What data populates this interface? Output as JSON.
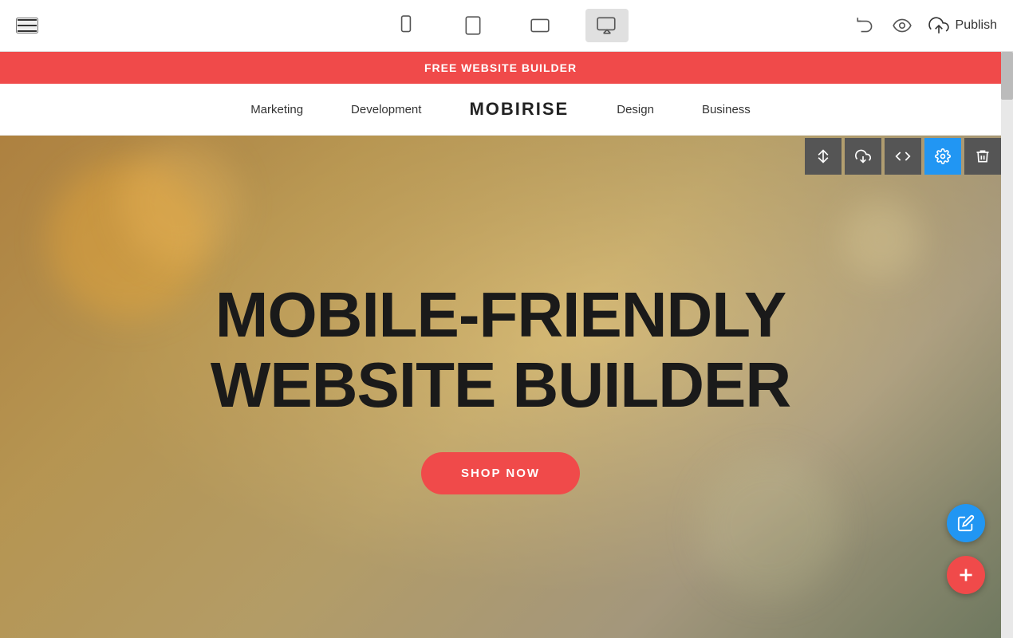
{
  "toolbar": {
    "publish_label": "Publish",
    "devices": [
      {
        "id": "mobile",
        "label": "Mobile",
        "active": false
      },
      {
        "id": "tablet",
        "label": "Tablet",
        "active": false
      },
      {
        "id": "tablet-landscape",
        "label": "Tablet Landscape",
        "active": false
      },
      {
        "id": "desktop",
        "label": "Desktop",
        "active": true
      }
    ]
  },
  "promo_banner": {
    "text": "FREE WEBSITE BUILDER"
  },
  "nav": {
    "logo": "MOBIRISE",
    "links": [
      "Marketing",
      "Development",
      "Design",
      "Business"
    ]
  },
  "hero": {
    "title_line1": "MOBILE-FRIENDLY",
    "title_line2": "WEBSITE BUILDER",
    "cta_label": "SHOP NOW"
  },
  "block_controls": [
    {
      "id": "move",
      "icon": "arrows-icon"
    },
    {
      "id": "download",
      "icon": "download-icon"
    },
    {
      "id": "code",
      "icon": "code-icon"
    },
    {
      "id": "settings",
      "icon": "settings-icon",
      "active": true
    },
    {
      "id": "delete",
      "icon": "delete-icon"
    }
  ],
  "fab": {
    "pencil_label": "Edit",
    "add_label": "Add Block"
  }
}
